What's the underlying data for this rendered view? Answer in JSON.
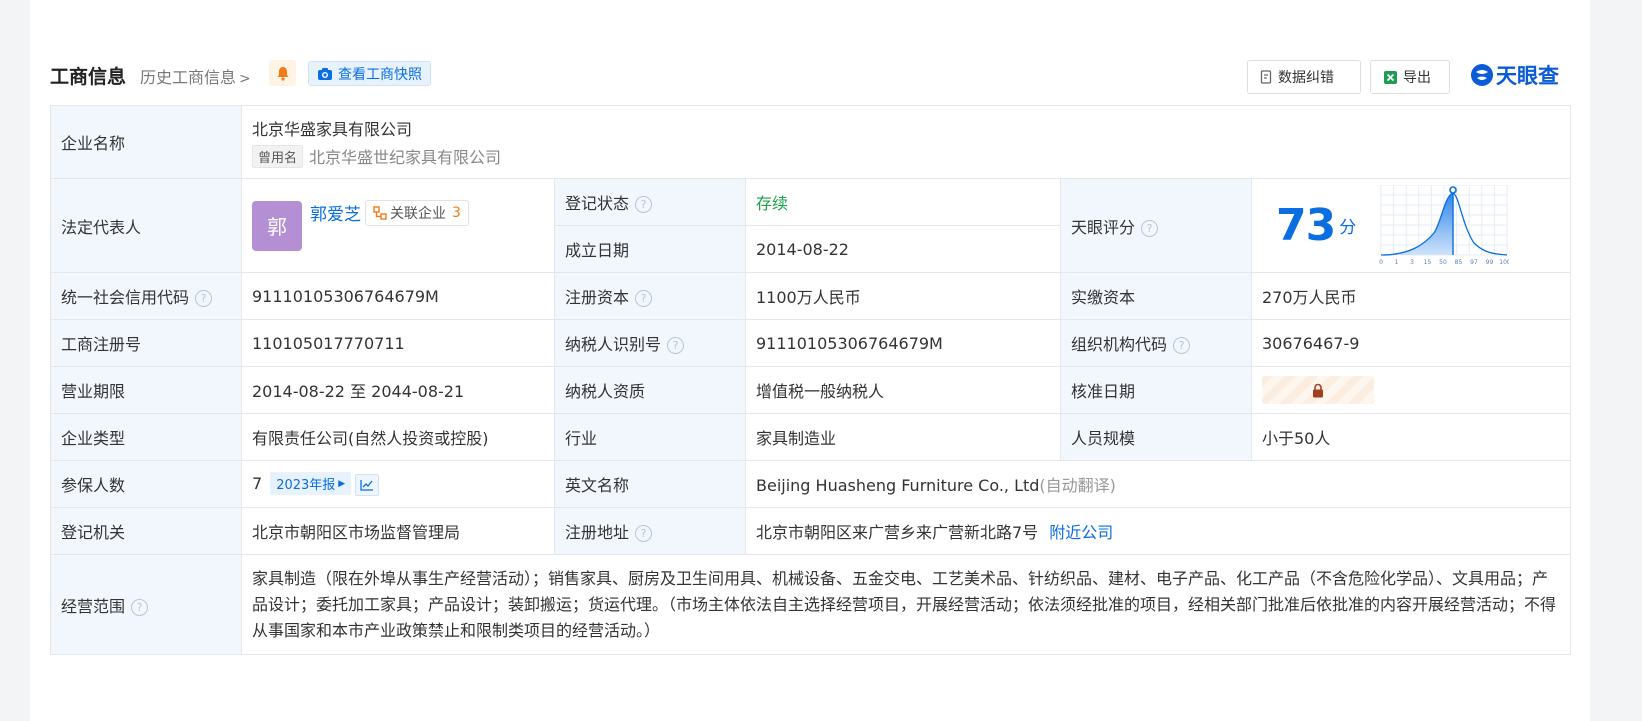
{
  "header": {
    "title": "工商信息",
    "history_link": "历史工商信息",
    "snapshot_button": "查看工商快照",
    "correct_button": "数据纠错",
    "export_button": "导出",
    "brand": "天眼查"
  },
  "company": {
    "name_label": "企业名称",
    "name": "北京华盛家具有限公司",
    "former_tag": "曾用名",
    "former_name": "北京华盛世纪家具有限公司",
    "legal_label": "法定代表人",
    "legal_avatar": "郭",
    "legal_name": "郭爱芝",
    "related_label": "关联企业",
    "related_count": "3",
    "reg_status_label": "登记状态",
    "reg_status": "存续",
    "est_date_label": "成立日期",
    "est_date": "2014-08-22",
    "score_label": "天眼评分",
    "score": "73",
    "score_unit": "分",
    "credit_code_label": "统一社会信用代码",
    "credit_code": "91110105306764679M",
    "reg_capital_label": "注册资本",
    "reg_capital": "1100万人民币",
    "paid_capital_label": "实缴资本",
    "paid_capital": "270万人民币",
    "reg_no_label": "工商注册号",
    "reg_no": "110105017770711",
    "taxpayer_id_label": "纳税人识别号",
    "taxpayer_id": "91110105306764679M",
    "org_code_label": "组织机构代码",
    "org_code": "30676467-9",
    "term_label": "营业期限",
    "term": "2014-08-22 至 2044-08-21",
    "taxpayer_qual_label": "纳税人资质",
    "taxpayer_qual": "增值税一般纳税人",
    "approval_label": "核准日期",
    "type_label": "企业类型",
    "type": "有限责任公司(自然人投资或控股)",
    "industry_label": "行业",
    "industry": "家具制造业",
    "staff_size_label": "人员规模",
    "staff_size": "小于50人",
    "insured_label": "参保人数",
    "insured": "7",
    "report_tag": "2023年报",
    "english_name_label": "英文名称",
    "english_name": "Beijing Huasheng Furniture Co., Ltd",
    "auto_translate": "(自动翻译)",
    "authority_label": "登记机关",
    "authority": "北京市朝阳区市场监督管理局",
    "address_label": "注册地址",
    "address": "北京市朝阳区来广营乡来广营新北路7号",
    "nearby_link": "附近公司",
    "scope_label": "经营范围",
    "scope": "家具制造（限在外埠从事生产经营活动）；销售家具、厨房及卫生间用具、机械设备、五金交电、工艺美术品、针纺织品、建材、电子产品、化工产品（不含危险化学品）、文具用品；产品设计；委托加工家具；产品设计；装卸搬运；货运代理。（市场主体依法自主选择经营项目，开展经营活动；依法须经批准的项目，经相关部门批准后依批准的内容开展经营活动；不得从事国家和本市产业政策禁止和限制类项目的经营活动。）"
  },
  "score_chart": {
    "ticks": [
      "0",
      "1",
      "3",
      "15",
      "50",
      "85",
      "97",
      "99",
      "100"
    ],
    "marker": 73
  },
  "colors": {
    "accent": "#0a6ee0",
    "status_green": "#1aa34a",
    "label_bg": "#f2f7fe",
    "avatar": "#b48fd4"
  }
}
